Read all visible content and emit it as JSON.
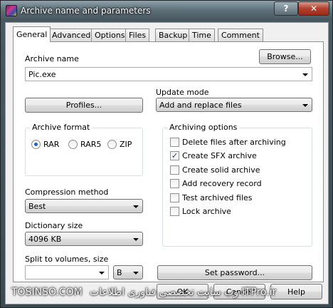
{
  "window": {
    "title": "Archive name and parameters",
    "help_label": "?",
    "close_label": "✕"
  },
  "tabs": [
    {
      "label": "General"
    },
    {
      "label": "Advanced"
    },
    {
      "label": "Options"
    },
    {
      "label": "Files"
    },
    {
      "label": "Backup"
    },
    {
      "label": "Time"
    },
    {
      "label": "Comment"
    }
  ],
  "archive_name": {
    "label": "Archive name",
    "value": "Pic.exe",
    "browse_label": "Browse..."
  },
  "profiles_label": "Profiles...",
  "update_mode": {
    "label": "Update mode",
    "value": "Add and replace files"
  },
  "archive_format": {
    "label": "Archive format",
    "options": [
      "RAR",
      "RAR5",
      "ZIP"
    ],
    "selected": "RAR"
  },
  "archiving_options": {
    "label": "Archiving options",
    "items": [
      {
        "label": "Delete files after archiving",
        "checked": false
      },
      {
        "label": "Create SFX archive",
        "checked": true
      },
      {
        "label": "Create solid archive",
        "checked": false
      },
      {
        "label": "Add recovery record",
        "checked": false
      },
      {
        "label": "Test archived files",
        "checked": false
      },
      {
        "label": "Lock archive",
        "checked": false
      }
    ]
  },
  "compression_method": {
    "label": "Compression method",
    "value": "Best"
  },
  "dictionary_size": {
    "label": "Dictionary size",
    "value": "4096 KB"
  },
  "split": {
    "label": "Split to volumes, size",
    "value": "",
    "unit": "B"
  },
  "set_password_label": "Set password...",
  "footer": {
    "ok_label": "OK",
    "cancel_label": "Cancel",
    "help_label": "Help"
  },
  "watermark": {
    "left": "TOSINSO.COM",
    "right": "وب سایت تخصصی فناوری اطلاعات ITPro.ir"
  },
  "check_glyph": "✓"
}
